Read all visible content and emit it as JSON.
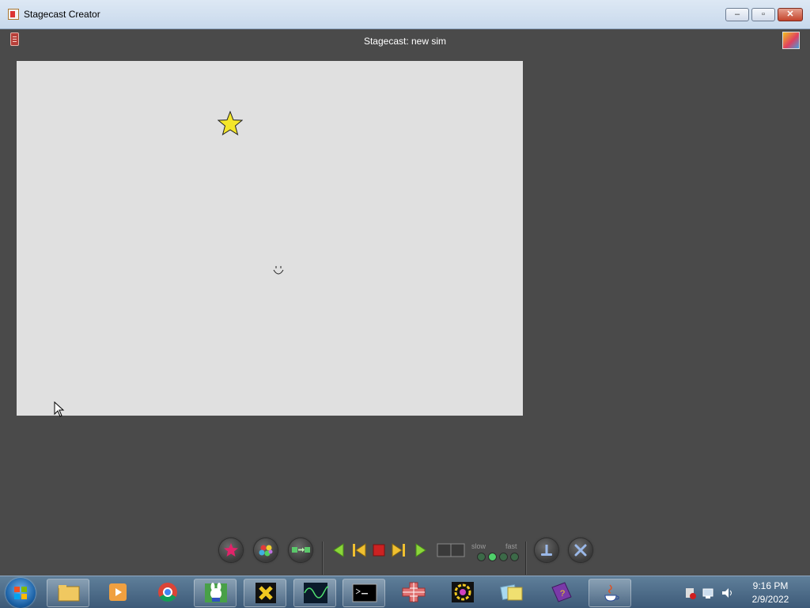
{
  "window": {
    "title": "Stagecast Creator",
    "minimize_label": "–",
    "maximize_label": "▫",
    "close_label": "✕"
  },
  "sim": {
    "title": "Stagecast: new sim"
  },
  "stage": {
    "background": "#e0e0e0",
    "sprites": [
      "star",
      "smiley-face"
    ]
  },
  "toolbar": {
    "buttons": [
      "characters",
      "new-character",
      "create-rule",
      "rewind",
      "step-back",
      "stop",
      "step-forward",
      "play",
      "split-view",
      "mail",
      "close"
    ],
    "speed": {
      "slow_label": "slow",
      "fast_label": "fast",
      "dots": 4,
      "selected": 2
    }
  },
  "taskbar": {
    "apps": [
      "windows-explorer",
      "media-player",
      "chrome",
      "bunny-app",
      "x-app",
      "oscilloscope-app",
      "command-prompt",
      "grid-app",
      "settings-app",
      "folder-app",
      "help-book",
      "java"
    ],
    "clock": {
      "time": "9:16 PM",
      "date": "2/9/2022"
    }
  },
  "colors": {
    "workspace": "#4a4a4a",
    "stage": "#e0e0e0",
    "accent_green": "#4fd06a",
    "accent_red": "#cc2222"
  }
}
